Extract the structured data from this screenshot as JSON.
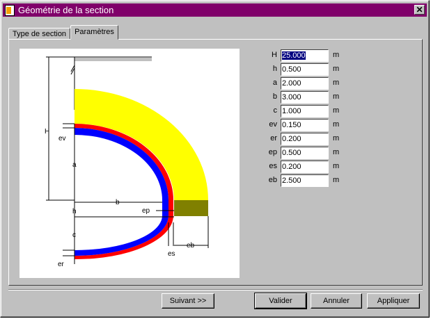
{
  "window": {
    "title": "Géométrie de la section",
    "close_glyph": "✕"
  },
  "tabs": [
    {
      "label": "Type de section",
      "active": false
    },
    {
      "label": "Paramètres",
      "active": true
    }
  ],
  "drawing_labels": {
    "H": "H",
    "ev": "ev",
    "a": "a",
    "b": "b",
    "ep": "ep",
    "h": "h",
    "c": "c",
    "er": "er",
    "es": "es",
    "eb": "eb"
  },
  "parameters": [
    {
      "label": "H",
      "value": "25.000",
      "unit": "m",
      "selected": true
    },
    {
      "label": "h",
      "value": "0.500",
      "unit": "m"
    },
    {
      "label": "a",
      "value": "2.000",
      "unit": "m"
    },
    {
      "label": "b",
      "value": "3.000",
      "unit": "m"
    },
    {
      "label": "c",
      "value": "1.000",
      "unit": "m"
    },
    {
      "label": "ev",
      "value": "0.150",
      "unit": "m"
    },
    {
      "label": "er",
      "value": "0.200",
      "unit": "m"
    },
    {
      "label": "ep",
      "value": "0.500",
      "unit": "m"
    },
    {
      "label": "es",
      "value": "0.200",
      "unit": "m"
    },
    {
      "label": "eb",
      "value": "2.500",
      "unit": "m"
    }
  ],
  "buttons": {
    "next": "Suivant >>",
    "validate": "Valider",
    "cancel": "Annuler",
    "apply": "Appliquer"
  },
  "colors": {
    "title_bar": "#80006a",
    "soil_fill": "#ffff00",
    "red_layer": "#ff0000",
    "blue_layer": "#0000ff",
    "base_block": "#808000"
  }
}
